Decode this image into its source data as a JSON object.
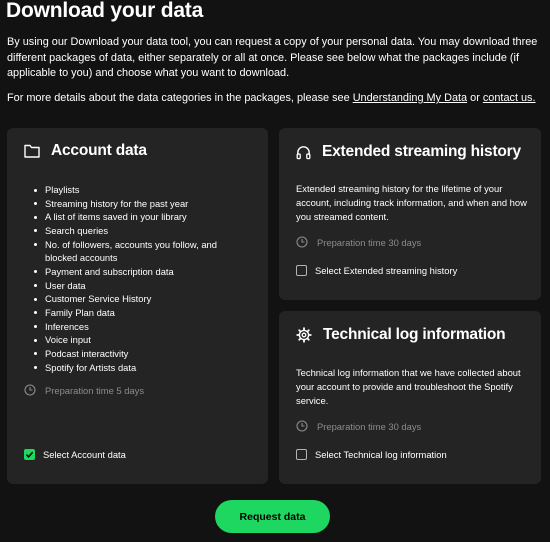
{
  "page": {
    "title": "Download your data",
    "intro": "By using our Download your data tool, you can request a copy of your personal data. You may download three different packages of data, either separately or all at once. Please see below what the packages include (if applicable to you) and choose what you want to download.",
    "details_prefix": "For more details about the data categories in the packages, please see ",
    "details_link_understanding": "Understanding My Data",
    "details_or": " or ",
    "details_link_contact": "contact us.",
    "request_button": "Request data"
  },
  "account_card": {
    "icon": "folder-icon",
    "title": "Account data",
    "items": [
      "Playlists",
      "Streaming history for the past year",
      "A list of items saved in your library",
      "Search queries",
      "No. of followers, accounts you follow, and blocked accounts",
      "Payment and subscription data",
      "User data",
      "Customer Service History",
      "Family Plan data",
      "Inferences",
      "Voice input",
      "Podcast interactivity",
      "Spotify for Artists data"
    ],
    "prep_time": "Preparation time 5 days",
    "select_label": "Select Account data",
    "selected": true
  },
  "streaming_card": {
    "icon": "headphones-icon",
    "title": "Extended streaming history",
    "description": "Extended streaming history for the lifetime of your account, including track information, and when and how you streamed content.",
    "prep_time": "Preparation time 30 days",
    "select_label": "Select Extended streaming history",
    "selected": false
  },
  "techlog_card": {
    "icon": "gear-icon",
    "title": "Technical log information",
    "description": "Technical log information that we have collected about your account to provide and troubleshoot the Spotify service.",
    "prep_time": "Preparation time 30 days",
    "select_label": "Select Technical log information",
    "selected": false
  },
  "colors": {
    "background": "#121212",
    "card": "#242424",
    "accent": "#1ed760",
    "muted": "#8c8c8c"
  }
}
